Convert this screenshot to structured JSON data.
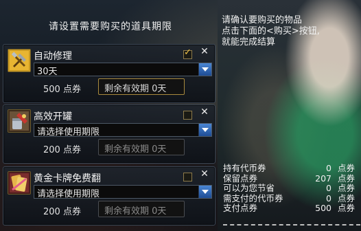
{
  "dialog": {
    "title": "请设置需要购买的道具期限"
  },
  "items": [
    {
      "name": "自动修理",
      "checked": true,
      "period_value": "30天",
      "price_amount": "500",
      "price_unit": "点券",
      "remaining_label": "剩余有效期",
      "remaining_value": "0天"
    },
    {
      "name": "高效开罐",
      "checked": false,
      "period_value": "请选择使用期限",
      "price_amount": "200",
      "price_unit": "点券",
      "remaining_label": "剩余有效期",
      "remaining_value": "0天"
    },
    {
      "name": "黄金卡牌免费翻",
      "checked": false,
      "period_value": "请选择使用期限",
      "price_amount": "200",
      "price_unit": "点券",
      "remaining_label": "剩余有效期",
      "remaining_value": "0天"
    }
  ],
  "info": {
    "lines": [
      "请确认要购买的物品",
      "点击下面的<购买>按钮,",
      "就能完成结算"
    ]
  },
  "summary": [
    {
      "label": "持有代币券",
      "value": "0",
      "unit": "点券"
    },
    {
      "label": "保留点券",
      "value": "207",
      "unit": "点券"
    },
    {
      "label": "可以为您节省",
      "value": "0",
      "unit": "点券"
    },
    {
      "label": "需支付的代币券",
      "value": "0",
      "unit": "点券"
    },
    {
      "label": "支付点券",
      "value": "500",
      "unit": "点券"
    }
  ],
  "icons": {
    "item_0": "repair-hammer-icon",
    "item_1": "can-opener-icon",
    "item_2": "gold-card-icon"
  },
  "colors": {
    "accent_gold": "#a98a3e",
    "dropdown_blue": "#2f6fc4",
    "panel_border": "#3b4756"
  }
}
